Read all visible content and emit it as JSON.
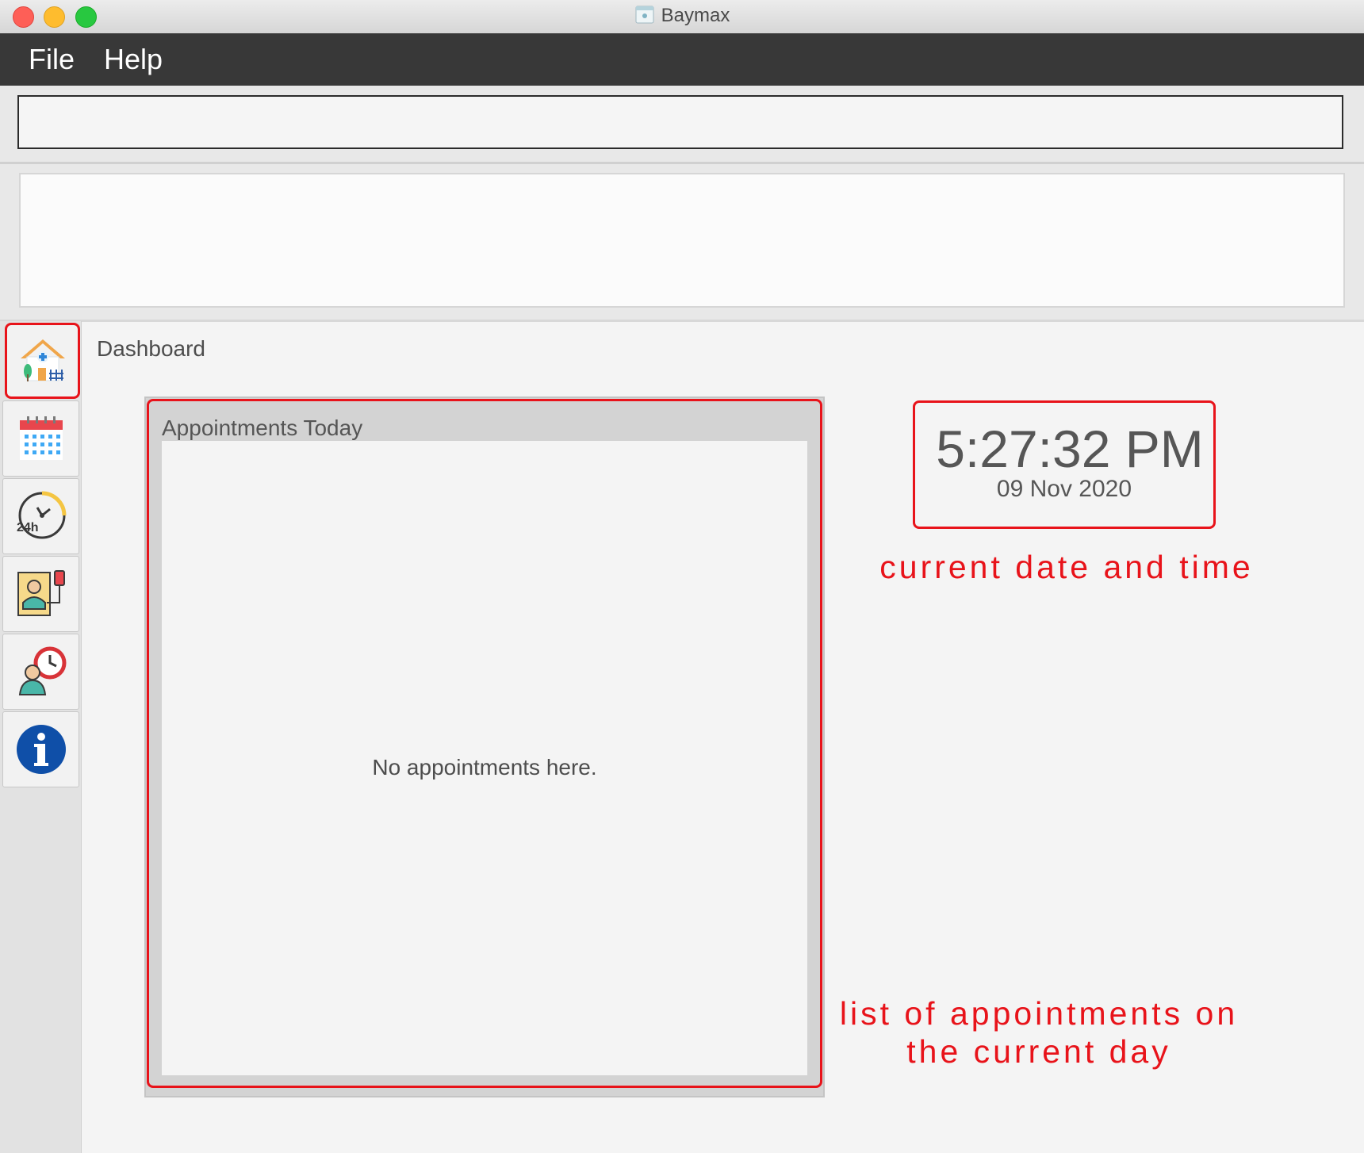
{
  "window": {
    "title": "Baymax"
  },
  "menu": {
    "file": "File",
    "help": "Help"
  },
  "command": {
    "value": "",
    "placeholder": ""
  },
  "result": {
    "text": ""
  },
  "sidebar": {
    "items": [
      {
        "name": "dashboard",
        "icon": "house-icon",
        "active": true
      },
      {
        "name": "calendar",
        "icon": "calendar-icon",
        "active": false
      },
      {
        "name": "schedule",
        "icon": "clock-24h-icon",
        "active": false
      },
      {
        "name": "patients",
        "icon": "patient-record-icon",
        "active": false
      },
      {
        "name": "appointments",
        "icon": "person-clock-icon",
        "active": false
      },
      {
        "name": "info",
        "icon": "info-icon",
        "active": false
      }
    ]
  },
  "dashboard": {
    "title": "Dashboard",
    "appointments_title": "Appointments Today",
    "empty_text": "No appointments here.",
    "time": "5:27:32 PM",
    "date": "09 Nov 2020"
  },
  "annotations": {
    "clock": "current date and time",
    "list_line1": "list of appointments on",
    "list_line2": "the current day"
  },
  "colors": {
    "menubar": "#383838",
    "annotation_red": "#e8131a",
    "panel_gray": "#d3d3d3"
  }
}
